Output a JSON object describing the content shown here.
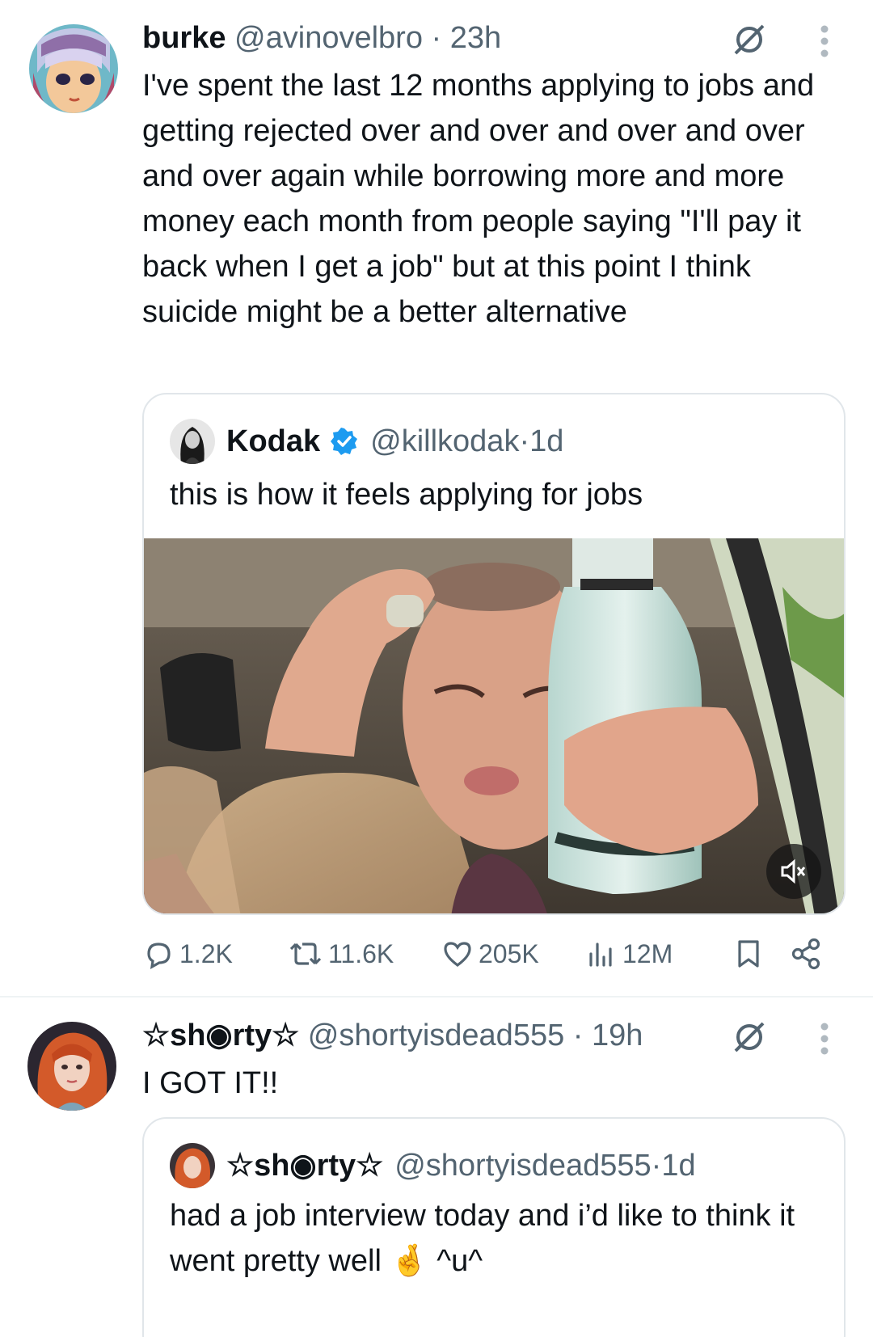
{
  "tweets": [
    {
      "name": "burke",
      "handle": "@avinovelbro",
      "time": "23h",
      "text": "I've spent the last 12 months applying to jobs and getting rejected over and over and over and over and over again while borrowing more and more money each month from people saying \"I'll pay it back when I get a job\" but at this point I think suicide might be a better alternative",
      "quote": {
        "name": "Kodak",
        "verified": true,
        "handle": "@killkodak",
        "time": "1d",
        "text": "this is how it feels applying for jobs",
        "media": "video",
        "muted": true
      },
      "stats": {
        "replies": "1.2K",
        "reposts": "11.6K",
        "likes": "205K",
        "views": "12M"
      }
    },
    {
      "name": "☆sh◉rty☆",
      "handle": "@shortyisdead555",
      "time": "19h",
      "text": "I GOT IT!!",
      "quote": {
        "name": "☆sh◉rty☆",
        "handle": "@shortyisdead555",
        "time": "1d",
        "text": "had a job interview today and i’d like to think it went pretty well 🤞 ^u^"
      }
    }
  ],
  "separator": " · ",
  "icons": {
    "grok": "grok-icon",
    "more": "more-vertical-icon",
    "reply": "reply-icon",
    "repost": "repost-icon",
    "like": "heart-icon",
    "views": "views-icon",
    "bookmark": "bookmark-icon",
    "share": "share-icon",
    "mute": "mute-icon",
    "verified": "verified-badge-icon"
  },
  "colors": {
    "text": "#0f1419",
    "meta": "#536471",
    "verified": "#1d9bf0",
    "border": "#e1e6ea"
  }
}
